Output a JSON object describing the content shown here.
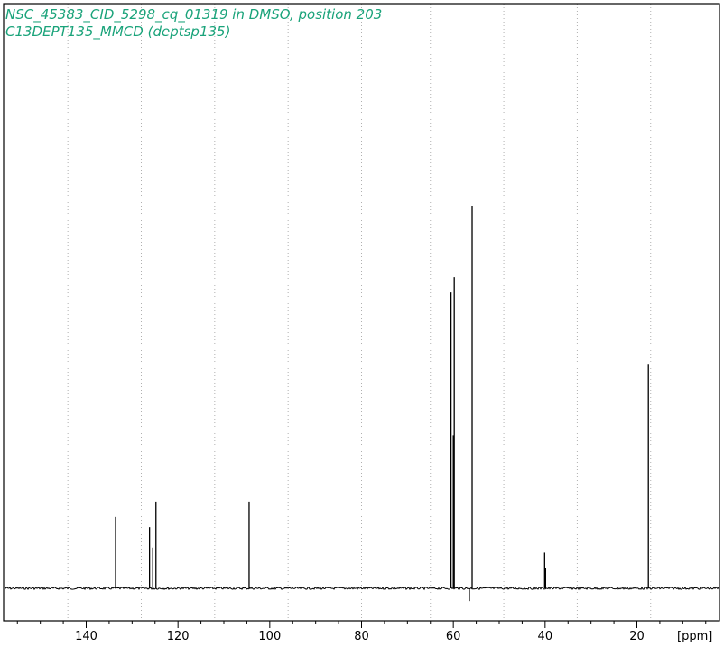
{
  "chart_data": {
    "type": "line",
    "title_lines": [
      "NSC_45383_CID_5298_cq_01319 in DMSO, position 203",
      "C13DEPT135_MMCD (deptsp135)"
    ],
    "xlabel": "[ppm]",
    "xlim": [
      158,
      2
    ],
    "x_reversed": true,
    "x_ticks": [
      140,
      120,
      100,
      80,
      60,
      40,
      20
    ],
    "x_tick_labels": [
      "140",
      "120",
      "100",
      "80",
      "60",
      "40",
      "20"
    ],
    "minor_tick_step": 5,
    "grid_lines_x": [
      144,
      128,
      112,
      96,
      80,
      65,
      49,
      33,
      17
    ],
    "ylim": [
      -0.06,
      1.0
    ],
    "baseline": 0,
    "colors": {
      "title": "#1aa37a",
      "spectrum": "#000000",
      "grid": "#b0b0b0",
      "axis": "#000000"
    },
    "series": [
      {
        "x": [
          133.6,
          126.2,
          125.5,
          124.8,
          104.5,
          60.5,
          60.0,
          59.8,
          56.5,
          55.9,
          40.1,
          39.9,
          17.5
        ],
        "y": [
          0.14,
          0.12,
          0.08,
          0.17,
          0.17,
          0.58,
          0.3,
          0.61,
          -0.025,
          0.75,
          0.07,
          0.04,
          0.44
        ]
      }
    ]
  }
}
